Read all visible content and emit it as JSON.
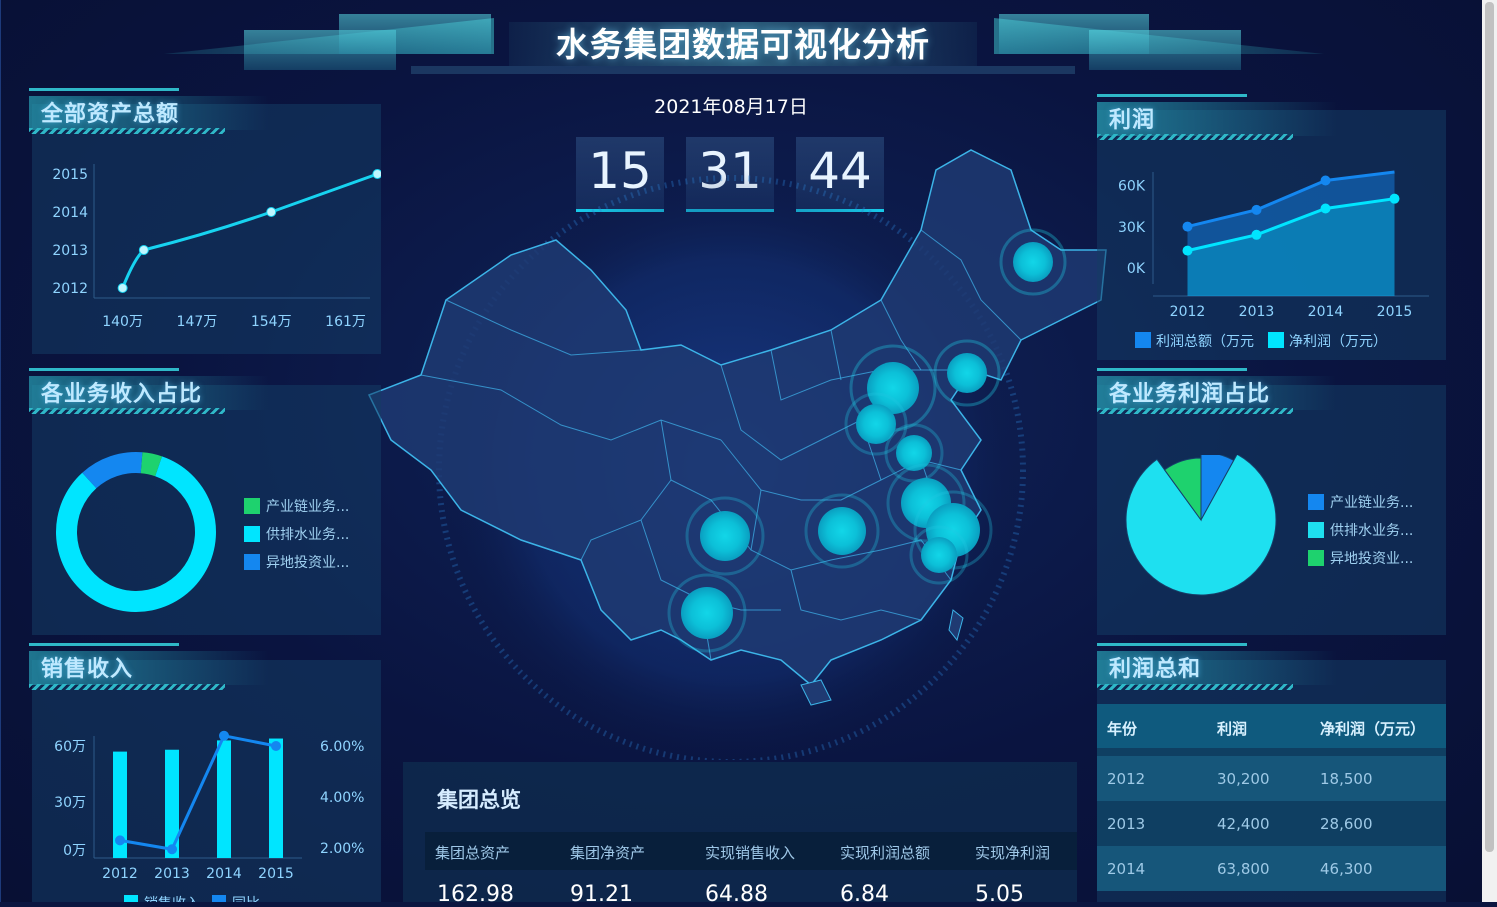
{
  "header": {
    "title": "水务集团数据可视化分析",
    "date": "2021年08月17日",
    "clock": {
      "hours": "15",
      "minutes": "31",
      "seconds": "44"
    }
  },
  "panels": {
    "total_assets": {
      "title": "全部资产总额",
      "chart_data": {
        "type": "line",
        "title": "全部资产总额",
        "y_categories": [
          "2012",
          "2013",
          "2014",
          "2015"
        ],
        "x_ticks": [
          "140万",
          "147万",
          "154万",
          "161万"
        ],
        "points": [
          {
            "x": 140,
            "y": "2012"
          },
          {
            "x": 142,
            "y": "2013"
          },
          {
            "x": 154,
            "y": "2014"
          },
          {
            "x": 164,
            "y": "2015"
          }
        ],
        "xlim": [
          139,
          165
        ],
        "color": "#17d3f0"
      }
    },
    "business_income_share": {
      "title": "各业务收入占比",
      "chart_data": {
        "type": "pie",
        "variant": "donut",
        "slices": [
          {
            "label": "产业链业务...",
            "value": 4,
            "color": "#1ed26e"
          },
          {
            "label": "供排水业务...",
            "value": 83,
            "color": "#00e5ff"
          },
          {
            "label": "异地投资业...",
            "value": 13,
            "color": "#1487f0"
          }
        ]
      }
    },
    "sales_revenue": {
      "title": "销售收入",
      "chart_data": {
        "type": "bar",
        "categories": [
          "2012",
          "2013",
          "2014",
          "2015"
        ],
        "series": [
          {
            "name": "销售收入",
            "type": "bar",
            "values": [
              57,
              58,
              63,
              64
            ],
            "color": "#00e5ff"
          },
          {
            "name": "同比",
            "type": "line",
            "axis": "right",
            "values": [
              2.3,
              1.95,
              6.4,
              6.0
            ],
            "color": "#1487f0"
          }
        ],
        "yticks_left": [
          "0万",
          "30万",
          "60万"
        ],
        "ylim_left": [
          0,
          60
        ],
        "yticks_right": [
          "2.00%",
          "4.00%",
          "6.00%"
        ],
        "ylim_right": [
          2,
          6
        ]
      }
    },
    "profit": {
      "title": "利润",
      "chart_data": {
        "type": "area",
        "categories": [
          "2012",
          "2013",
          "2014",
          "2015"
        ],
        "series": [
          {
            "name": "利润总额（万元",
            "values": [
              30200,
              42400,
              63800,
              70000
            ],
            "color": "#1487f0"
          },
          {
            "name": "净利润（万元）",
            "values": [
              18500,
              28600,
              46300,
              52000
            ],
            "color": "#00e5ff"
          }
        ],
        "yticks": [
          "0K",
          "30K",
          "60K"
        ],
        "ylim": [
          0,
          70000
        ]
      }
    },
    "business_profit_share": {
      "title": "各业务利润占比",
      "chart_data": {
        "type": "pie",
        "slices": [
          {
            "label": "产业链业务...",
            "value": 8,
            "color": "#1487f0"
          },
          {
            "label": "供排水业务...",
            "value": 82,
            "color": "#1ee0f0"
          },
          {
            "label": "异地投资业...",
            "value": 10,
            "color": "#1ed26e"
          }
        ]
      }
    },
    "profit_sum": {
      "title": "利润总和",
      "columns": [
        "年份",
        "利润",
        "净利润（万元）"
      ],
      "rows": [
        [
          "2012",
          "30,200",
          "18,500"
        ],
        [
          "2013",
          "42,400",
          "28,600"
        ],
        [
          "2014",
          "63,800",
          "46,300"
        ]
      ]
    }
  },
  "overview": {
    "title": "集团总览",
    "columns": [
      "集团总资产",
      "集团净资产",
      "实现销售收入",
      "实现利润总额",
      "实现净利润"
    ],
    "values": [
      "162.98",
      "91.21",
      "64.88",
      "6.84",
      "5.05"
    ]
  },
  "map": {
    "hotspots": [
      "黑龙江",
      "北京",
      "河北",
      "天津",
      "山东",
      "江苏",
      "上海",
      "浙江",
      "湖北",
      "重庆",
      "云南"
    ]
  }
}
